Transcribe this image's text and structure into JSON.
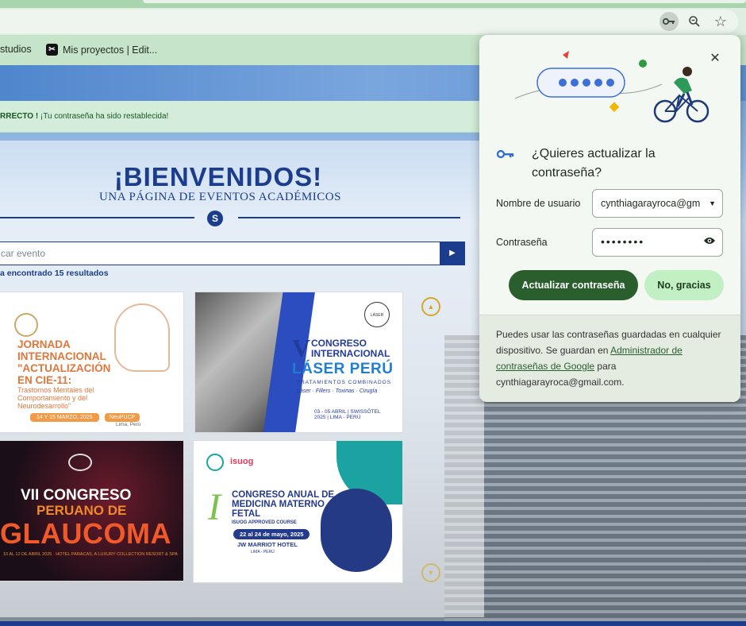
{
  "browser": {
    "bookmarks": [
      {
        "label": "studios"
      },
      {
        "label": "Mis proyectos | Edit..."
      }
    ],
    "icons": [
      "key-icon",
      "zoom-icon",
      "star-icon"
    ]
  },
  "page": {
    "alert_strong": "RRECTO !",
    "alert_text": " ¡Tu contraseña ha sido restablecida!",
    "welcome": "¡BIENVENIDOS!",
    "subtitle": "UNA PÁGINA DE EVENTOS ACADÉMICOS",
    "search_placeholder": "car evento",
    "results": "a encontrado 15 resultados",
    "cards": [
      {
        "lines": [
          "JORNADA",
          "INTERNACIONAL",
          "\"ACTUALIZACIÓN",
          "EN CIE-11:"
        ],
        "sub": [
          "Trastornos Mentales del",
          "Comportamiento y del",
          "Neurodesarrollo\""
        ],
        "date": "14 Y 15 MARZO, 2025",
        "org": "NeuPUCP",
        "place": "Lima, Perú"
      },
      {
        "roman": "V",
        "lines": [
          "CONGRESO",
          "INTERNACIONAL"
        ],
        "big": "LÁSER PERÚ",
        "tag": "TRATAMIENTOS COMBINADOS",
        "tag2": "Láser · Fillers · Toxinas · Cirugía",
        "date": "03 - 05 ABRIL | SWISSÔTEL",
        "date2": "2025 | LIMA - PERÚ"
      },
      {
        "l1": "VII CONGRESO",
        "l2": "PERUANO DE",
        "l3": "GLAUCOMA",
        "small": "10 AL 12 DE ABRIL 2025 · HOTEL PARACAS, A LUXURY COLLECTION RESORT & SPA"
      },
      {
        "brand": "isuog",
        "roman": "I",
        "lines": [
          "CONGRESO ANUAL DE",
          "MEDICINA MATERNO",
          "FETAL"
        ],
        "course": "ISUOG APPROVED COURSE",
        "date": "22 al 24 de mayo, 2025",
        "hotel": "JW MARRIOT HOTEL",
        "place": "LIMA - PERÚ"
      }
    ]
  },
  "popup": {
    "title": "¿Quieres actualizar la contraseña?",
    "username_label": "Nombre de usuario",
    "username_value": "cynthiagarayroca@gmail.com",
    "password_label": "Contraseña",
    "password_value": "••••••••",
    "update_button": "Actualizar contraseña",
    "no_button": "No, gracias",
    "footer_pre": "Puedes usar las contraseñas guardadas en cualquier dispositivo. Se guardan en ",
    "footer_link": "Administrador de contraseñas de Google",
    "footer_post": " para cynthiagarayroca@gmail.com.",
    "colors": {
      "primary": "#2a5e2d",
      "secondary": "#c3efc4"
    }
  }
}
